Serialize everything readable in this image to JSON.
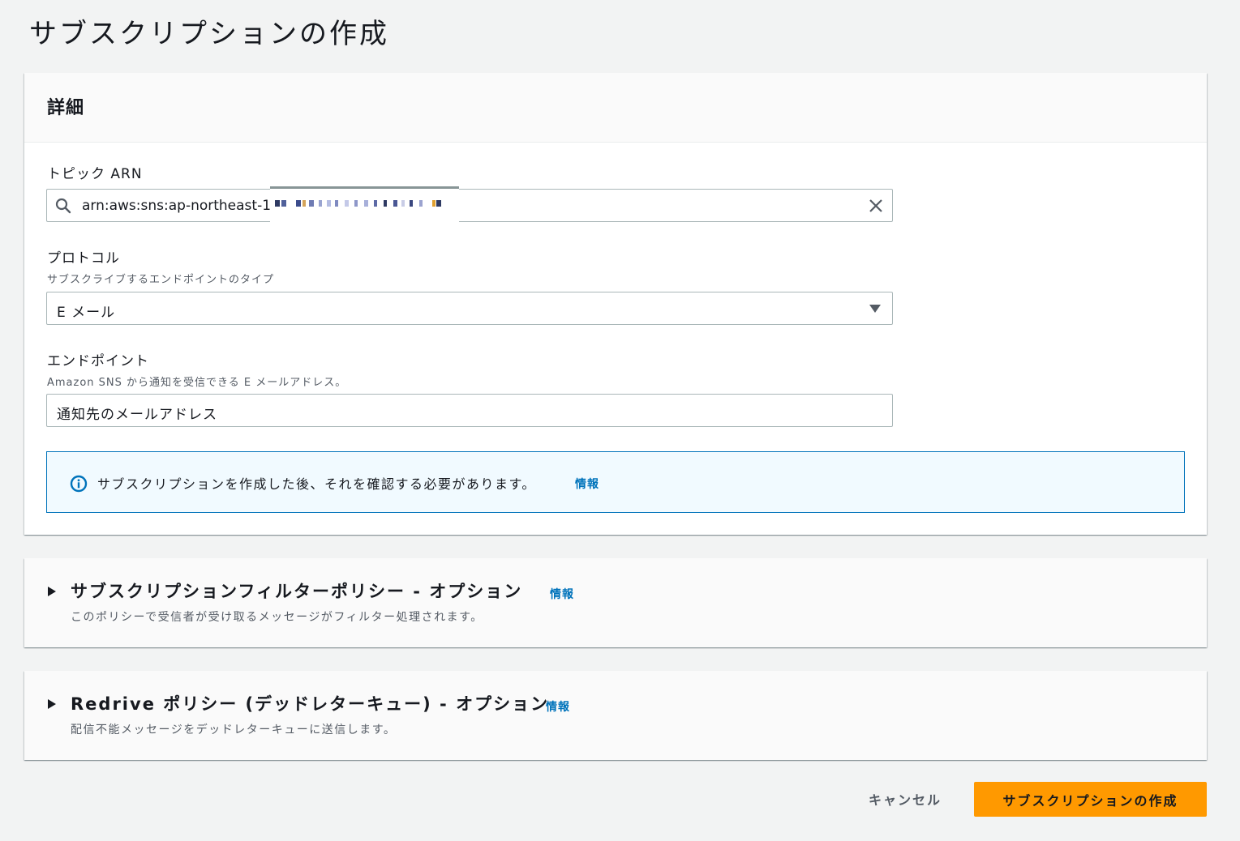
{
  "page_title": "サブスクリプションの作成",
  "details": {
    "heading": "詳細",
    "topic_arn": {
      "label": "トピック ARN",
      "value": "arn:aws:sns:ap-northeast-1"
    },
    "protocol": {
      "label": "プロトコル",
      "description": "サブスクライブするエンドポイントのタイプ",
      "selected": "E メール"
    },
    "endpoint": {
      "label": "エンドポイント",
      "description": "Amazon SNS から通知を受信できる E メールアドレス。",
      "value": "通知先のメールアドレス"
    },
    "alert": {
      "message": "サブスクリプションを作成した後、それを確認する必要があります。",
      "link": "情報"
    }
  },
  "filter_policy": {
    "title": "サブスクリプションフィルターポリシー - オプション",
    "link": "情報",
    "description": "このポリシーで受信者が受け取るメッセージがフィルター処理されます。"
  },
  "redrive_policy": {
    "title": "Redrive ポリシー (デッドレターキュー) - オプション",
    "link": "情報",
    "description": "配信不能メッセージをデッドレターキューに送信します。"
  },
  "actions": {
    "cancel": "キャンセル",
    "create": "サブスクリプションの作成"
  },
  "colors": {
    "primary_button": "#ff9900",
    "link": "#0073bb",
    "alert_bg": "#f1faff"
  }
}
